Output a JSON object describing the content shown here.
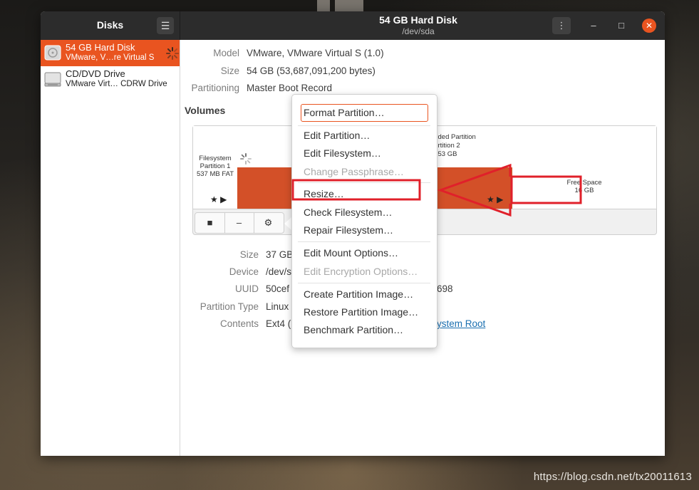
{
  "window": {
    "sidebar_title": "Disks",
    "disk_title": "54 GB Hard Disk",
    "disk_path": "/dev/sda"
  },
  "sidebar": {
    "items": [
      {
        "name": "54 GB Hard Disk",
        "sub": "VMware, V…re Virtual S",
        "icon": "hard-disk-icon"
      },
      {
        "name": "CD/DVD Drive",
        "sub": "VMware Virt… CDRW Drive",
        "icon": "optical-drive-icon"
      }
    ]
  },
  "disk_info": {
    "model_label": "Model",
    "model": "VMware, VMware Virtual S (1.0)",
    "size_label": "Size",
    "size": "54 GB (53,687,091,200 bytes)",
    "partitioning_label": "Partitioning",
    "partitioning": "Master Boot Record"
  },
  "volumes": {
    "header": "Volumes",
    "part1": {
      "line1": "Filesystem",
      "line2": "Partition 1",
      "line3": "537 MB FAT"
    },
    "extended": {
      "line1": "…ded Partition",
      "line2": "…rtition 2",
      "line3": "…53 GB"
    },
    "free": {
      "line1": "Free Space",
      "line2": "16 GB"
    },
    "toolbar": {
      "stop": "■",
      "minus": "–",
      "gear": "⚙"
    }
  },
  "partition_info": {
    "size_label": "Size",
    "size": "37 GB",
    "device_label": "Device",
    "device": "/dev/s",
    "uuid_label": "UUID",
    "uuid_a": "50cef",
    "uuid_b": "698",
    "type_label": "Partition Type",
    "type": "Linux",
    "contents_label": "Contents",
    "contents": "Ext4 (",
    "contents_link": "ystem Root"
  },
  "context_menu": {
    "format": "Format Partition…",
    "edit_partition": "Edit Partition…",
    "edit_filesystem": "Edit Filesystem…",
    "change_passphrase": "Change Passphrase…",
    "resize": "Resize…",
    "check_filesystem": "Check Filesystem…",
    "repair_filesystem": "Repair Filesystem…",
    "edit_mount": "Edit Mount Options…",
    "edit_encryption": "Edit Encryption Options…",
    "create_image": "Create Partition Image…",
    "restore_image": "Restore Partition Image…",
    "benchmark": "Benchmark Partition…"
  },
  "watermark": "https://blog.csdn.net/tx20011613",
  "colors": {
    "accent": "#e95420",
    "partition_fill": "#d35028",
    "annotation_red": "#e0202a"
  }
}
